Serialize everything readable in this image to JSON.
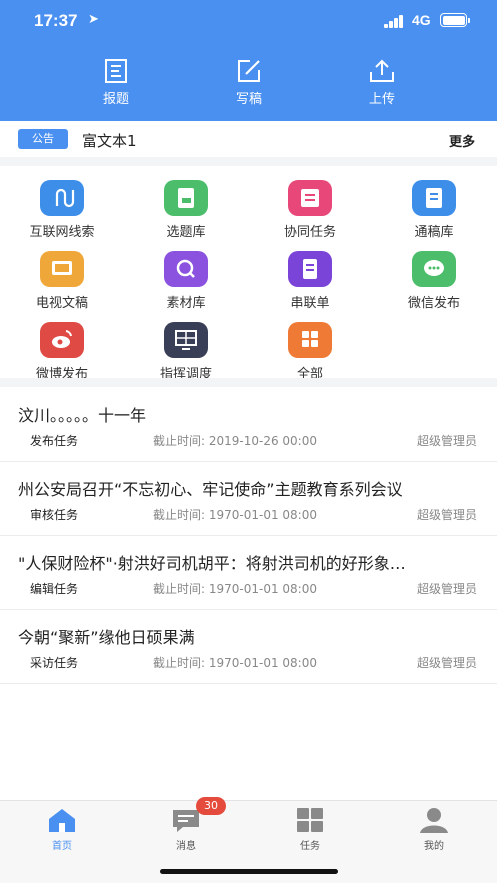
{
  "status_bar": {
    "time": "17:37",
    "network": "4G"
  },
  "header": {
    "actions": [
      {
        "label": "报题",
        "icon": "report-topic-icon"
      },
      {
        "label": "写稿",
        "icon": "write-draft-icon"
      },
      {
        "label": "上传",
        "icon": "upload-icon"
      }
    ]
  },
  "notice": {
    "tag": "公告",
    "text": "富文本1",
    "more": "更多"
  },
  "grid": {
    "items": [
      {
        "label": "互联网线索",
        "icon": "internet-clue-icon",
        "color": "#3d8ee8"
      },
      {
        "label": "选题库",
        "icon": "topic-library-icon",
        "color": "#4cbe6b"
      },
      {
        "label": "协同任务",
        "icon": "collab-task-icon",
        "color": "#e8477a"
      },
      {
        "label": "通稿库",
        "icon": "wire-library-icon",
        "color": "#3d8ee8"
      },
      {
        "label": "电视文稿",
        "icon": "tv-script-icon",
        "color": "#f0a73a"
      },
      {
        "label": "素材库",
        "icon": "material-library-icon",
        "color": "#8b52e0"
      },
      {
        "label": "串联单",
        "icon": "rundown-icon",
        "color": "#7a44d8"
      },
      {
        "label": "微信发布",
        "icon": "wechat-icon",
        "color": "#4cbe6b"
      },
      {
        "label": "微博发布",
        "icon": "weibo-icon",
        "color": "#e04a45"
      },
      {
        "label": "指挥调度",
        "icon": "command-dispatch-icon",
        "color": "#3a3f58"
      },
      {
        "label": "全部",
        "icon": "all-apps-icon",
        "color": "#ef7a36"
      }
    ]
  },
  "tasks": [
    {
      "title": "汶川。。。。。十一年",
      "type": "发布任务",
      "deadline": "截止时间: 2019-10-26 00:00",
      "owner": "超级管理员"
    },
    {
      "title": "州公安局召开“不忘初心、牢记使命”主题教育系列会议",
      "type": "审核任务",
      "deadline": "截止时间: 1970-01-01 08:00",
      "owner": "超级管理员"
    },
    {
      "title": "\"人保财险杯\"·射洪好司机胡平：将射洪司机的好形象…",
      "type": "编辑任务",
      "deadline": "截止时间: 1970-01-01 08:00",
      "owner": "超级管理员"
    },
    {
      "title": "今朝“聚新”缘他日硕果满",
      "type": "采访任务",
      "deadline": "截止时间: 1970-01-01 08:00",
      "owner": "超级管理员"
    }
  ],
  "tabbar": {
    "tabs": [
      {
        "label": "首页",
        "icon": "home-icon",
        "active": true
      },
      {
        "label": "消息",
        "icon": "message-icon",
        "badge": "30"
      },
      {
        "label": "任务",
        "icon": "task-grid-icon"
      },
      {
        "label": "我的",
        "icon": "profile-icon"
      }
    ]
  },
  "colors": {
    "primary": "#4a90f0",
    "badge": "#e54b3c",
    "background": "#f3f4f6"
  }
}
